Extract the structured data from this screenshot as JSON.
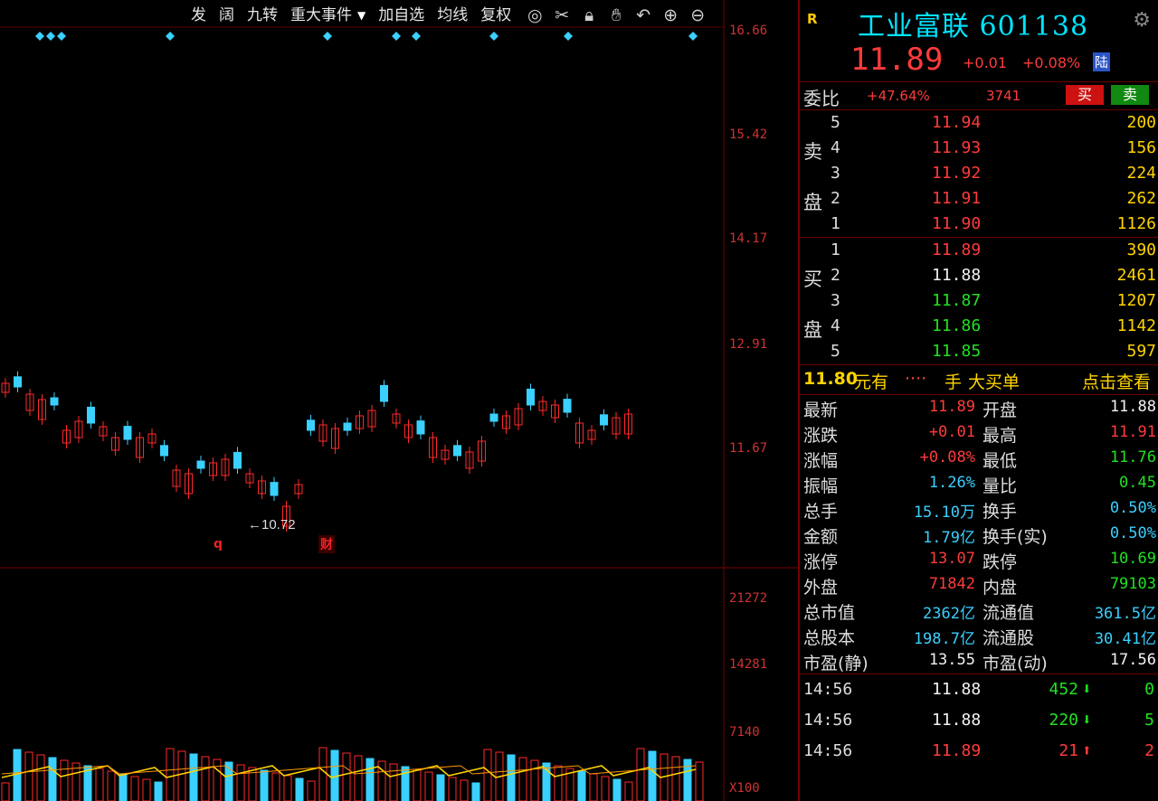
{
  "toolbar": {
    "items": [
      "发",
      "阔",
      "九转",
      "重大事件",
      "加自选",
      "均线",
      "复权"
    ],
    "icons": [
      "eye-icon",
      "scissors-icon",
      "lock-icon",
      "hand-icon",
      "undo-icon",
      "zoom-in-icon",
      "zoom-out-icon"
    ]
  },
  "chart_data": {
    "type": "candlestick",
    "y_axis_labels": [
      "16.66",
      "15.42",
      "14.17",
      "12.91",
      "11.67"
    ],
    "volume_axis_labels": [
      "21272",
      "14281",
      "7140",
      "X100"
    ],
    "low_marker": "10.72",
    "events": [
      "q",
      "财"
    ],
    "colors": {
      "up": "#ff2a2a",
      "down": "#3ad0ff",
      "ma": "#ffd400",
      "ma2": "#ff9900"
    }
  },
  "quote": {
    "r_badge": "R",
    "name": "工业富联 601138",
    "price": "11.89",
    "change": "+0.01",
    "change_pct": "+0.08%",
    "market_tag": "陆"
  },
  "weibi": {
    "label": "委比",
    "pct": "+47.64%",
    "diff": "3741",
    "buy": "买",
    "sell": "卖"
  },
  "sell_side_label": [
    "卖",
    "盘"
  ],
  "buy_side_label": [
    "买",
    "盘"
  ],
  "asks": [
    {
      "level": "5",
      "price": "11.94",
      "vol": "200"
    },
    {
      "level": "4",
      "price": "11.93",
      "vol": "156"
    },
    {
      "level": "3",
      "price": "11.92",
      "vol": "224"
    },
    {
      "level": "2",
      "price": "11.91",
      "vol": "262"
    },
    {
      "level": "1",
      "price": "11.90",
      "vol": "1126"
    }
  ],
  "bids": [
    {
      "level": "1",
      "price": "11.89",
      "vol": "390",
      "color": "red"
    },
    {
      "level": "2",
      "price": "11.88",
      "vol": "2461",
      "color": "white"
    },
    {
      "level": "3",
      "price": "11.87",
      "vol": "1207",
      "color": "green"
    },
    {
      "level": "4",
      "price": "11.86",
      "vol": "1142",
      "color": "green"
    },
    {
      "level": "5",
      "price": "11.85",
      "vol": "597",
      "color": "green"
    }
  ],
  "big_order": {
    "price": "11.80",
    "unit": "元有",
    "dots": "····",
    "shou": "手",
    "text": "大买单",
    "link": "点击查看"
  },
  "stats": [
    {
      "l": "最新",
      "lv": "11.89",
      "lc": "red",
      "r": "开盘",
      "rv": "11.88",
      "rc": "white"
    },
    {
      "l": "涨跌",
      "lv": "+0.01",
      "lc": "red",
      "r": "最高",
      "rv": "11.91",
      "rc": "red"
    },
    {
      "l": "涨幅",
      "lv": "+0.08%",
      "lc": "red",
      "r": "最低",
      "rv": "11.76",
      "rc": "green"
    },
    {
      "l": "振幅",
      "lv": "1.26%",
      "lc": "cyan",
      "r": "量比",
      "rv": "0.45",
      "rc": "green"
    },
    {
      "l": "总手",
      "lv": "15.10万",
      "lc": "cyan",
      "r": "换手",
      "rv": "0.50%",
      "rc": "cyan"
    },
    {
      "l": "金额",
      "lv": "1.79亿",
      "lc": "cyan",
      "r": "换手(实)",
      "rv": "0.50%",
      "rc": "cyan"
    },
    {
      "l": "涨停",
      "lv": "13.07",
      "lc": "red",
      "r": "跌停",
      "rv": "10.69",
      "rc": "green"
    },
    {
      "l": "外盘",
      "lv": "71842",
      "lc": "red",
      "r": "内盘",
      "rv": "79103",
      "rc": "green"
    },
    {
      "l": "总市值",
      "lv": "2362亿",
      "lc": "cyan",
      "r": "流通值",
      "rv": "361.5亿",
      "rc": "cyan"
    },
    {
      "l": "总股本",
      "lv": "198.7亿",
      "lc": "cyan",
      "r": "流通股",
      "rv": "30.41亿",
      "rc": "cyan"
    },
    {
      "l": "市盈(静)",
      "lv": "13.55",
      "lc": "white",
      "r": "市盈(动)",
      "rv": "17.56",
      "rc": "white"
    }
  ],
  "ticks": [
    {
      "time": "14:56",
      "price": "11.88",
      "pc": "white",
      "vol": "452",
      "vc": "green",
      "arrow": "down",
      "n": "0"
    },
    {
      "time": "14:56",
      "price": "11.88",
      "pc": "white",
      "vol": "220",
      "vc": "green",
      "arrow": "down",
      "n": "5"
    },
    {
      "time": "14:56",
      "price": "11.89",
      "pc": "red",
      "vol": "21",
      "vc": "red",
      "arrow": "up",
      "n": "2"
    }
  ]
}
